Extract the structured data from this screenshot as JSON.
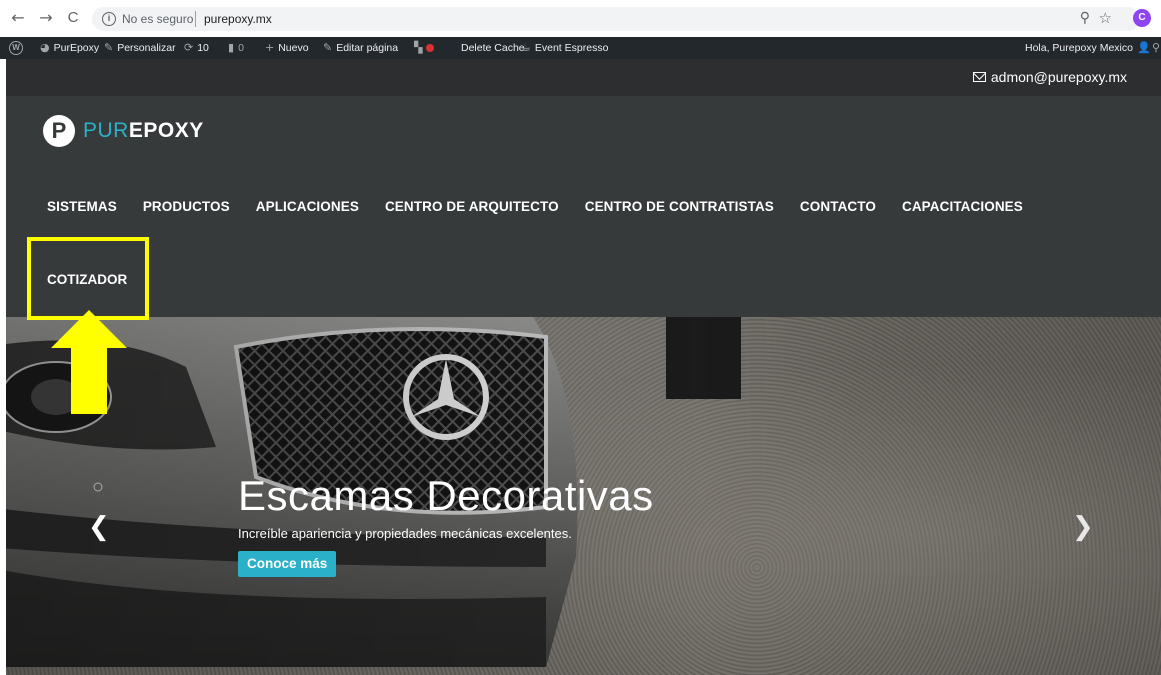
{
  "browser": {
    "back_glyph": "←",
    "forward_glyph": "→",
    "reload_glyph": "C",
    "security_text": "No es seguro",
    "url": "purepoxy.mx",
    "zoom_glyph": "⚲",
    "star_glyph": "☆",
    "profile_initial": "C",
    "profile_color": "#8e44ef"
  },
  "adminbar": {
    "site_name": "PurEpoxy",
    "customize": "Personalizar",
    "updates_count": "10",
    "comments_count": "0",
    "new": "Nuevo",
    "edit_page": "Editar página",
    "delete_cache": "Delete Cache",
    "event_espresso": "Event Espresso",
    "greeting": "Hola, Purepoxy Mexico"
  },
  "header": {
    "email": "admon@purepoxy.mx",
    "logo_initial": "P",
    "logo_part1": "PUR",
    "logo_part2": "EPOXY",
    "accent_color": "#2ab1c9",
    "menu": [
      "SISTEMAS",
      "PRODUCTOS",
      "APLICACIONES",
      "CENTRO DE ARQUITECTO",
      "CENTRO DE CONTRATISTAS",
      "CONTACTO",
      "CAPACITACIONES"
    ],
    "menu_row2": "COTIZADOR"
  },
  "hero": {
    "title": "Escamas Decorativas",
    "subtitle": "Increíble apariencia y propiedades mecánicas excelentes.",
    "button": "Conoce más",
    "prev_glyph": "❮",
    "next_glyph": "❯"
  },
  "annotation": {
    "color": "#ffff00"
  }
}
